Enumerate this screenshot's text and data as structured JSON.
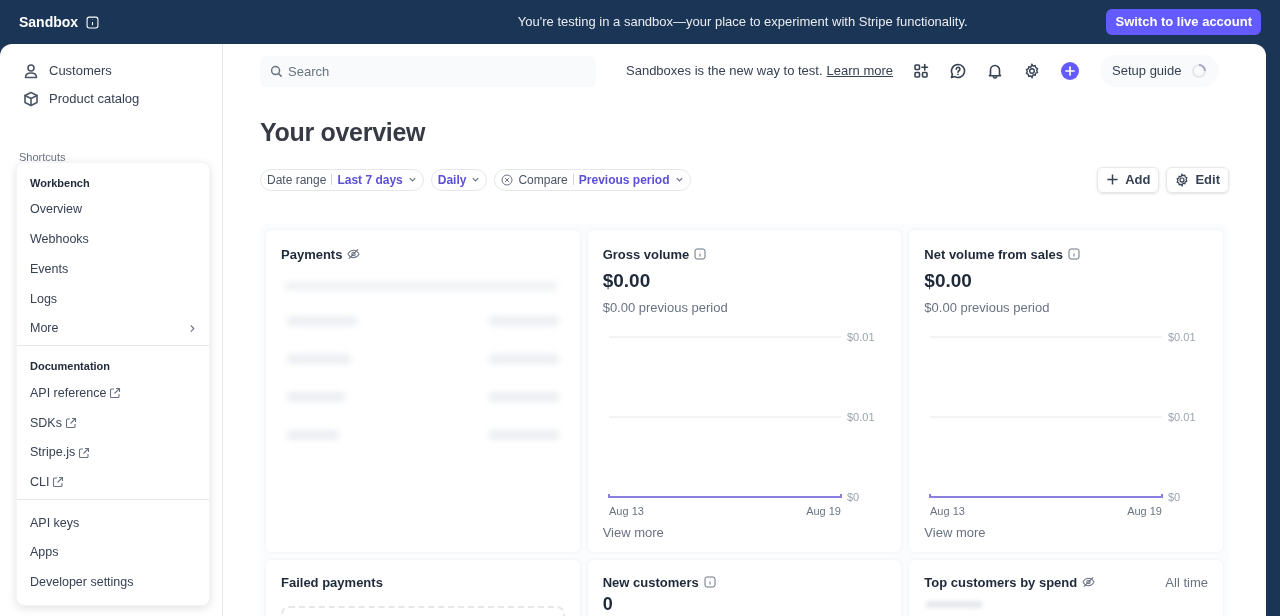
{
  "top_banner": {
    "mode_label": "Sandbox",
    "message": "You're testing in a sandbox—your place to experiment with Stripe functionality.",
    "button": "Switch to live account"
  },
  "sidebar": {
    "items": [
      {
        "label": "Customers"
      },
      {
        "label": "Product catalog"
      }
    ],
    "section_label": "Shortcuts"
  },
  "shortcuts_menu": {
    "groups": [
      {
        "title": "Workbench",
        "items": [
          {
            "label": "Overview",
            "kind": "plain"
          },
          {
            "label": "Webhooks",
            "kind": "plain"
          },
          {
            "label": "Events",
            "kind": "plain"
          },
          {
            "label": "Logs",
            "kind": "plain"
          },
          {
            "label": "More",
            "kind": "submenu"
          }
        ]
      },
      {
        "title": "Documentation",
        "items": [
          {
            "label": "API reference",
            "kind": "external"
          },
          {
            "label": "SDKs",
            "kind": "external"
          },
          {
            "label": "Stripe.js",
            "kind": "external"
          },
          {
            "label": "CLI",
            "kind": "external"
          }
        ]
      },
      {
        "items": [
          {
            "label": "API keys",
            "kind": "plain"
          },
          {
            "label": "Apps",
            "kind": "plain"
          },
          {
            "label": "Developer settings",
            "kind": "plain"
          }
        ]
      }
    ]
  },
  "header": {
    "search_placeholder": "Search",
    "notice": "Sandboxes is the new way to test.",
    "notice_link": "Learn more",
    "setup_guide": "Setup guide"
  },
  "title": "Your overview",
  "filters": [
    {
      "kind": "labelled",
      "label": "Date range",
      "value": "Last 7 days"
    },
    {
      "kind": "plain",
      "value": "Daily"
    },
    {
      "kind": "removable",
      "label": "Compare",
      "value": "Previous period"
    }
  ],
  "actions": [
    {
      "label": "Add"
    },
    {
      "label": "Edit"
    }
  ],
  "cards": [
    {
      "kind": "blurred",
      "title": "Payments"
    },
    {
      "kind": "metric",
      "title": "Gross volume",
      "value": "$0.00",
      "comparison": "$0.00 previous period",
      "link": "View more",
      "chart": {
        "y_labels": [
          "$0.01",
          "$0.01",
          "$0"
        ],
        "x_labels": [
          "Aug 13",
          "Aug 19"
        ]
      }
    },
    {
      "kind": "metric",
      "title": "Net volume from sales",
      "value": "$0.00",
      "comparison": "$0.00 previous period",
      "link": "View more",
      "chart": {
        "y_labels": [
          "$0.01",
          "$0.01",
          "$0"
        ],
        "x_labels": [
          "Aug 13",
          "Aug 19"
        ]
      }
    },
    {
      "kind": "empty",
      "title": "Failed payments"
    },
    {
      "kind": "count",
      "title": "New customers",
      "value": "0"
    },
    {
      "kind": "blurred",
      "title": "Top customers by spend",
      "period": "All time"
    }
  ]
}
